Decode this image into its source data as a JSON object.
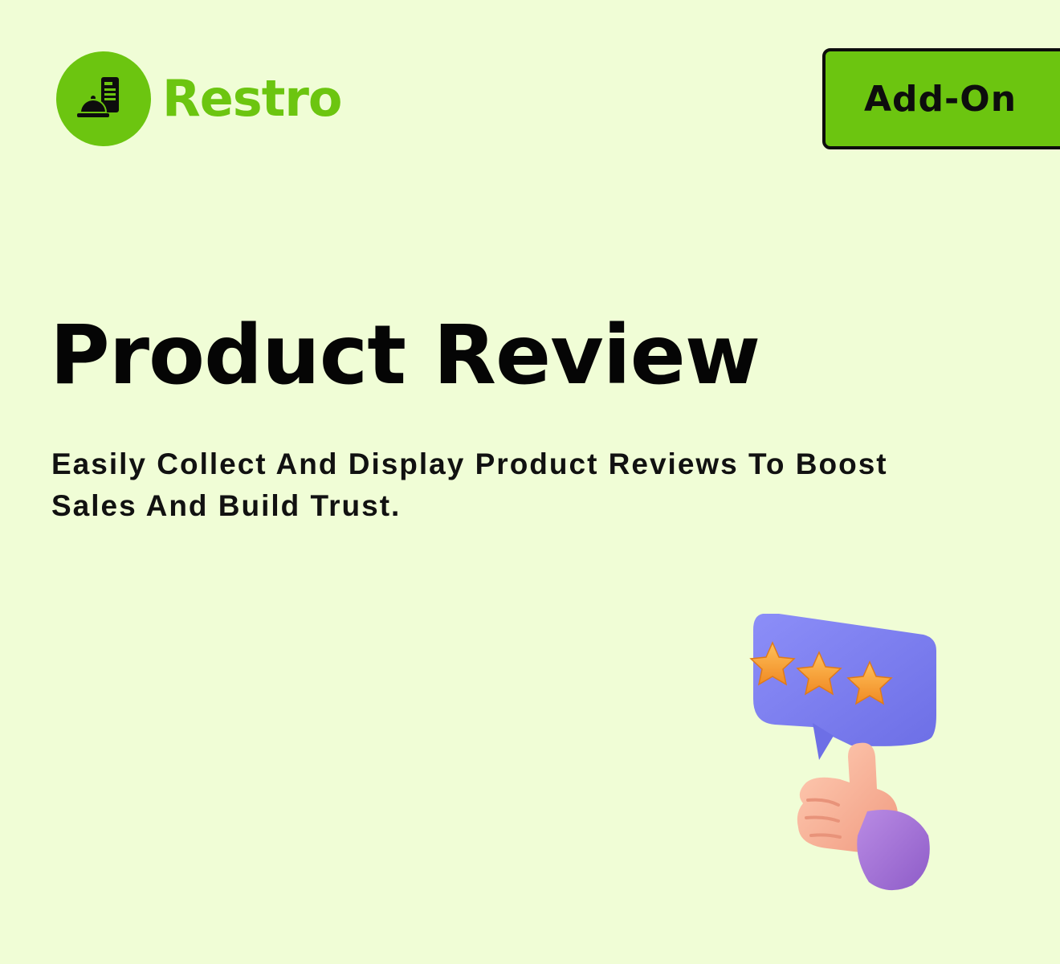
{
  "brand": {
    "name": "Restro",
    "icon": "restaurant-bell-icon",
    "color": "#6cc510"
  },
  "badge": {
    "label": "Add-On"
  },
  "hero": {
    "title": "Product Review",
    "description": "Easily Collect And Display Product Reviews To Boost Sales And Build Trust."
  },
  "illustration": {
    "icon": "thumbs-up-review-icon",
    "stars": 3,
    "bubble_color": "#7b7df2",
    "star_color": "#f7a838"
  },
  "colors": {
    "background": "#f0fdd6",
    "accent": "#6cc510",
    "text": "#050505"
  }
}
